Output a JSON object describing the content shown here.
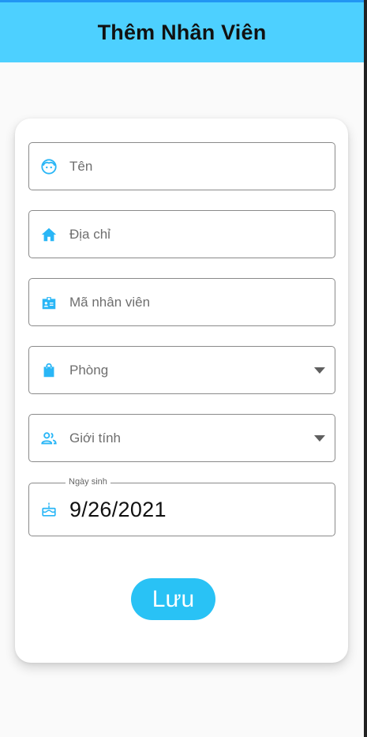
{
  "app_bar": {
    "title": "Thêm Nhân Viên"
  },
  "form": {
    "name_field": {
      "icon": "face-icon",
      "placeholder": "Tên"
    },
    "address_field": {
      "icon": "home-icon",
      "placeholder": "Địa chỉ"
    },
    "employee_id_field": {
      "icon": "badge-icon",
      "placeholder": "Mã nhân viên"
    },
    "department_field": {
      "icon": "shopping-bag-icon",
      "placeholder": "Phòng"
    },
    "gender_field": {
      "icon": "people-icon",
      "placeholder": "Giới tính"
    },
    "birthday_field": {
      "icon": "cake-icon",
      "label": "Ngày sinh",
      "value": "9/26/2021"
    },
    "save_label": "Lưu"
  },
  "colors": {
    "app_bar": "#4dd0ff",
    "accent": "#29c2f5",
    "icon": "#29b6f6",
    "top_line": "#2196f3"
  }
}
